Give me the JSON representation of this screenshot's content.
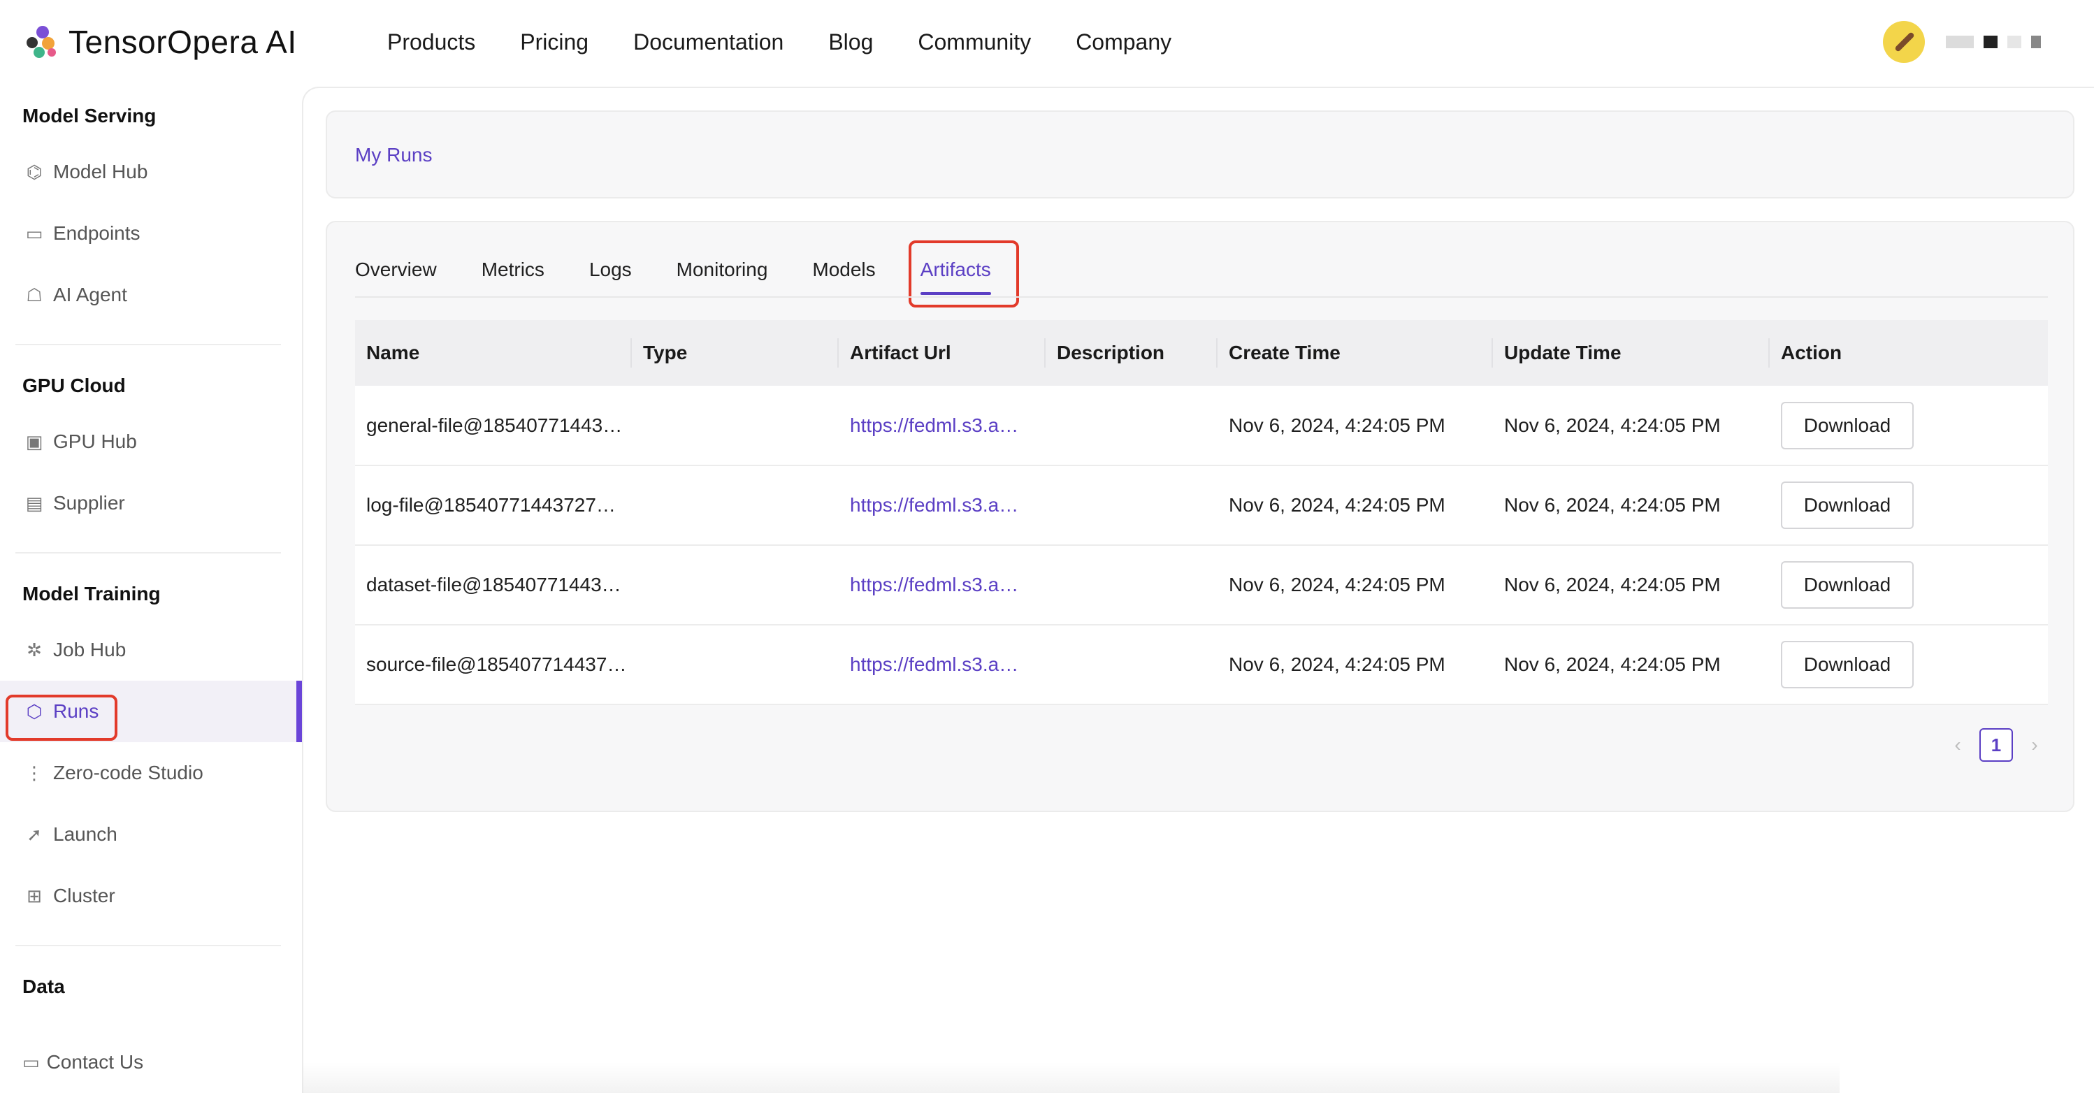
{
  "brand": {
    "name": "TensorOpera AI"
  },
  "nav": [
    "Products",
    "Pricing",
    "Documentation",
    "Blog",
    "Community",
    "Company"
  ],
  "sidebar": {
    "sections": [
      {
        "title": "Model Serving",
        "items": [
          {
            "label": "Model Hub",
            "icon": "model-hub-icon"
          },
          {
            "label": "Endpoints",
            "icon": "endpoints-icon"
          },
          {
            "label": "AI Agent",
            "icon": "ai-agent-icon"
          }
        ]
      },
      {
        "title": "GPU Cloud",
        "items": [
          {
            "label": "GPU Hub",
            "icon": "gpu-hub-icon"
          },
          {
            "label": "Supplier",
            "icon": "supplier-icon"
          }
        ]
      },
      {
        "title": "Model Training",
        "items": [
          {
            "label": "Job Hub",
            "icon": "job-hub-icon"
          },
          {
            "label": "Runs",
            "icon": "runs-icon"
          },
          {
            "label": "Zero-code Studio",
            "icon": "studio-icon"
          },
          {
            "label": "Launch",
            "icon": "rocket-icon"
          },
          {
            "label": "Cluster",
            "icon": "cluster-icon"
          }
        ]
      },
      {
        "title": "Data",
        "items": []
      }
    ],
    "active_item": "Runs",
    "contact": "Contact Us"
  },
  "breadcrumb": "My Runs",
  "tabs": [
    "Overview",
    "Metrics",
    "Logs",
    "Monitoring",
    "Models",
    "Artifacts"
  ],
  "active_tab": "Artifacts",
  "table": {
    "columns": [
      "Name",
      "Type",
      "Artifact Url",
      "Description",
      "Create Time",
      "Update Time",
      "Action"
    ],
    "rows": [
      {
        "name": "general-file@18540771443…",
        "type": "",
        "url": "https://fedml.s3.a…",
        "description": "",
        "create": "Nov 6, 2024, 4:24:05 PM",
        "update": "Nov 6, 2024, 4:24:05 PM",
        "action": "Download"
      },
      {
        "name": "log-file@18540771443727…",
        "type": "",
        "url": "https://fedml.s3.a…",
        "description": "",
        "create": "Nov 6, 2024, 4:24:05 PM",
        "update": "Nov 6, 2024, 4:24:05 PM",
        "action": "Download"
      },
      {
        "name": "dataset-file@18540771443…",
        "type": "",
        "url": "https://fedml.s3.a…",
        "description": "",
        "create": "Nov 6, 2024, 4:24:05 PM",
        "update": "Nov 6, 2024, 4:24:05 PM",
        "action": "Download"
      },
      {
        "name": "source-file@185407714437…",
        "type": "",
        "url": "https://fedml.s3.a…",
        "description": "",
        "create": "Nov 6, 2024, 4:24:05 PM",
        "update": "Nov 6, 2024, 4:24:05 PM",
        "action": "Download"
      }
    ]
  },
  "pagination": {
    "current": "1",
    "prev": "‹",
    "next": "›"
  },
  "colors": {
    "accent": "#5b3fc4",
    "highlight": "#e23a2a"
  }
}
